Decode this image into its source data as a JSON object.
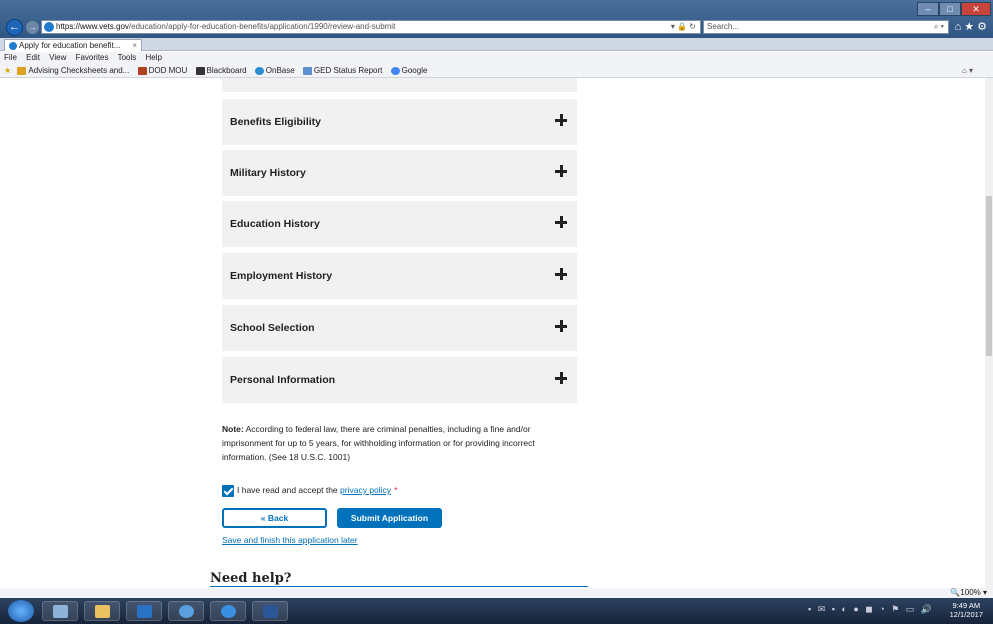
{
  "browser": {
    "url_host": "https://www.vets.gov",
    "url_path": "/education/apply-for-education-benefits/application/1990/review-and-submit",
    "url_tools": "▾ 🔒 ↻",
    "search_placeholder": "Search...",
    "tab_title": "Apply for education benefit...",
    "menu": [
      "File",
      "Edit",
      "View",
      "Favorites",
      "Tools",
      "Help"
    ],
    "favorites": [
      {
        "label": "Advising Checksheets and...",
        "color": "#e0a020"
      },
      {
        "label": "DOD MOU",
        "color": "#b04020"
      },
      {
        "label": "Blackboard",
        "color": "#333333"
      },
      {
        "label": "OnBase",
        "color": "#2a8fd0"
      },
      {
        "label": "GED Status Report",
        "color": "#5b8fd0"
      },
      {
        "label": "Google",
        "color": "#4285f4"
      }
    ],
    "zoom": "🔍100% ▾"
  },
  "sections": [
    {
      "title": "Benefits Eligibility"
    },
    {
      "title": "Military History"
    },
    {
      "title": "Education History"
    },
    {
      "title": "Employment History"
    },
    {
      "title": "School Selection"
    },
    {
      "title": "Personal Information"
    }
  ],
  "note": {
    "label": "Note:",
    "text": " According to federal law, there are criminal penalties, including a fine and/or imprisonment for up to 5 years, for withholding information or for providing incorrect information. (See 18 U.S.C. 1001)"
  },
  "privacy": {
    "prefix": "I have read and accept the ",
    "link": "privacy policy",
    "required": "*"
  },
  "buttons": {
    "back": "« Back",
    "submit": "Submit Application",
    "save_later": "Save and finish this application later"
  },
  "help": {
    "heading": "Need help?"
  },
  "taskbar": {
    "time": "9:49 AM",
    "date": "12/1/2017",
    "apps": [
      {
        "name": "file-explorer",
        "color": "#8fb3d8"
      },
      {
        "name": "folder",
        "color": "#e8c060"
      },
      {
        "name": "outlook",
        "color": "#2a72c4"
      },
      {
        "name": "cloud",
        "color": "#5aa0e0"
      },
      {
        "name": "internet-explorer",
        "color": "#3a8fe0"
      },
      {
        "name": "word",
        "color": "#2b5797"
      }
    ]
  },
  "colors": {
    "accent": "#0071bb",
    "required": "#e31c3d",
    "panel": "#f1f1f1"
  }
}
